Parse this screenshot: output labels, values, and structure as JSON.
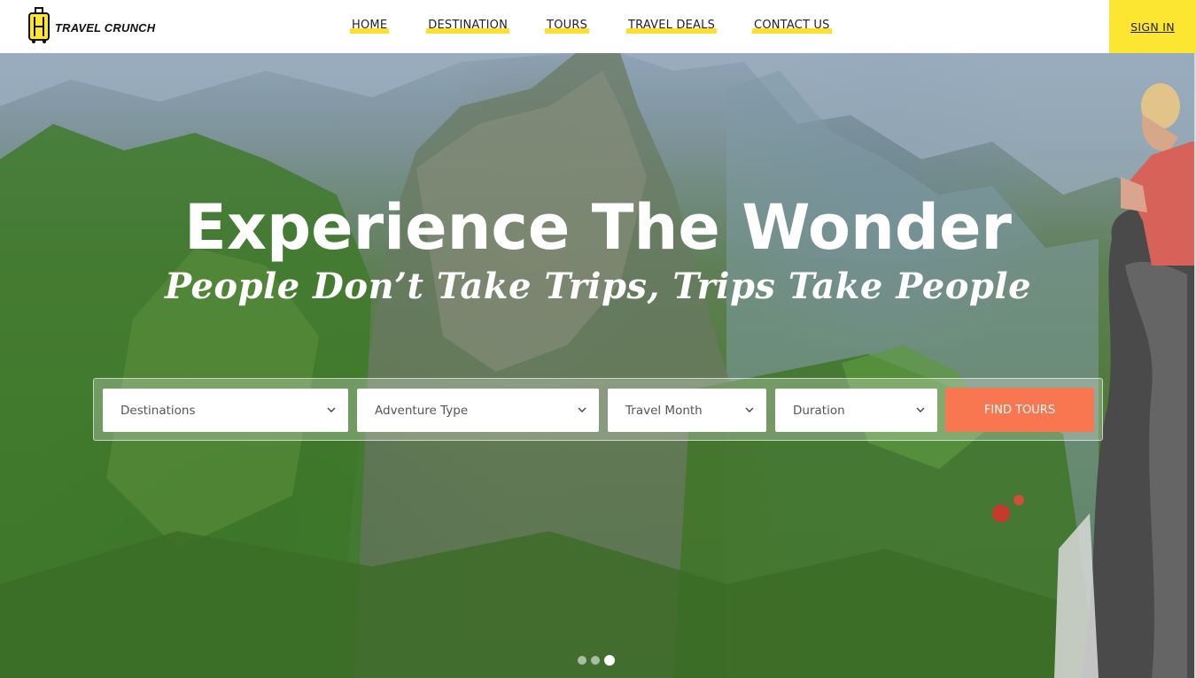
{
  "brand": {
    "name": "TRAVEL CRUNCH",
    "accent": "#fde631"
  },
  "nav": {
    "items": [
      {
        "label": "HOME"
      },
      {
        "label": "DESTINATION"
      },
      {
        "label": "TOURS"
      },
      {
        "label": "TRAVEL DEALS"
      },
      {
        "label": "CONTACT US"
      }
    ],
    "signin_label": "SIGN IN"
  },
  "hero": {
    "title": "Experience The Wonder",
    "subtitle": "People Don’t Take Trips, Trips Take People"
  },
  "search": {
    "fields": [
      {
        "label": "Destinations",
        "icon": "chevron-down-icon"
      },
      {
        "label": "Adventure Type",
        "icon": "chevron-down-icon"
      },
      {
        "label": "Travel Month",
        "icon": "chevron-down-icon"
      },
      {
        "label": "Duration",
        "icon": "chevron-down-icon"
      }
    ],
    "button_label": "FIND TOURS",
    "button_color": "#f87650"
  },
  "slider": {
    "count": 3,
    "active": 3
  }
}
